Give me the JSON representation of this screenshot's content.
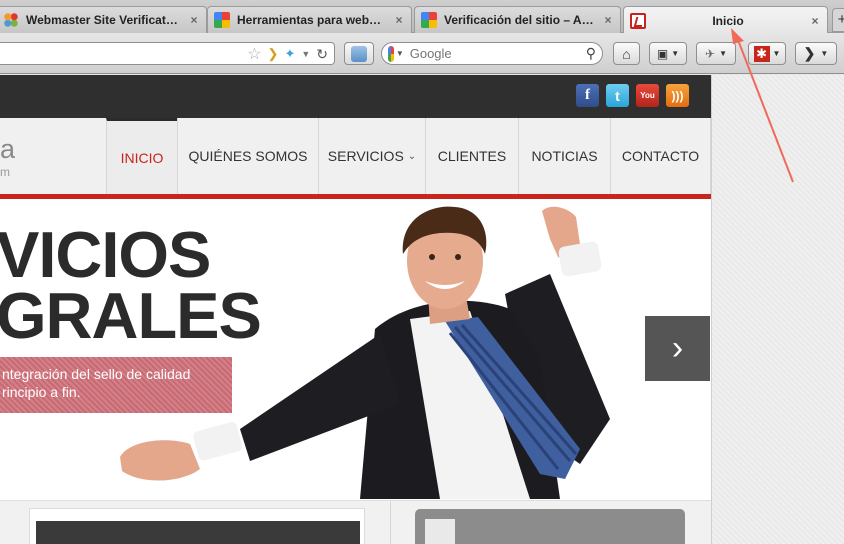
{
  "tabs": [
    {
      "title": "Webmaster Site Verificat…",
      "favicon": "joomla-icon"
    },
    {
      "title": "Herramientas para web…",
      "favicon": "google-icon"
    },
    {
      "title": "Verificación del sitio – A…",
      "favicon": "google-icon"
    },
    {
      "title": "Inicio",
      "favicon": "site-logo-icon",
      "active": true
    }
  ],
  "tab_close_glyph": "×",
  "newtab_glyph": "+",
  "search": {
    "placeholder": "Google"
  },
  "social": {
    "facebook": "f",
    "twitter": "t",
    "youtube": "You",
    "rss": ")))"
  },
  "site": {
    "logo_fragment": "a",
    "logo_sub": "m",
    "menu": [
      {
        "label": "INICIO",
        "active": true
      },
      {
        "label": "QUIÉNES SOMOS"
      },
      {
        "label": "SERVICIOS",
        "dropdown": true
      },
      {
        "label": "CLIENTES"
      },
      {
        "label": "NOTICIAS"
      },
      {
        "label": "CONTACTO"
      }
    ],
    "hero": {
      "line1": "VICIOS",
      "line2": "GRALES",
      "tagline1": "ntegración del sello de calidad",
      "tagline2": "rincipio a fin."
    }
  },
  "colors": {
    "accent_red": "#c8261c",
    "annotation_arrow": "#f06a5a"
  }
}
